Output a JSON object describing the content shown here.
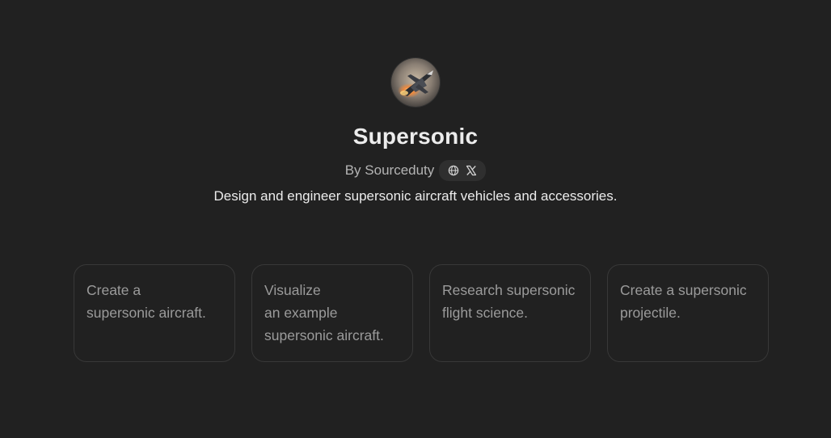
{
  "gpt": {
    "name": "Supersonic",
    "author": "By Sourceduty",
    "description": "Design and engineer supersonic aircraft vehicles and accessories.",
    "avatar_icon": "supersonic-jet-avatar",
    "links": [
      {
        "icon": "globe-icon"
      },
      {
        "icon": "x-logo-icon"
      }
    ]
  },
  "starters": [
    {
      "text": "Create a\nsupersonic aircraft."
    },
    {
      "text": "Visualize\nan example\nsupersonic aircraft."
    },
    {
      "text": "Research supersonic\nflight science."
    },
    {
      "text": "Create a supersonic\nprojectile."
    }
  ],
  "colors": {
    "background": "#212121",
    "card_border": "#383838",
    "muted_text": "#9b9b9b",
    "pill_background": "#2f2f2f"
  }
}
